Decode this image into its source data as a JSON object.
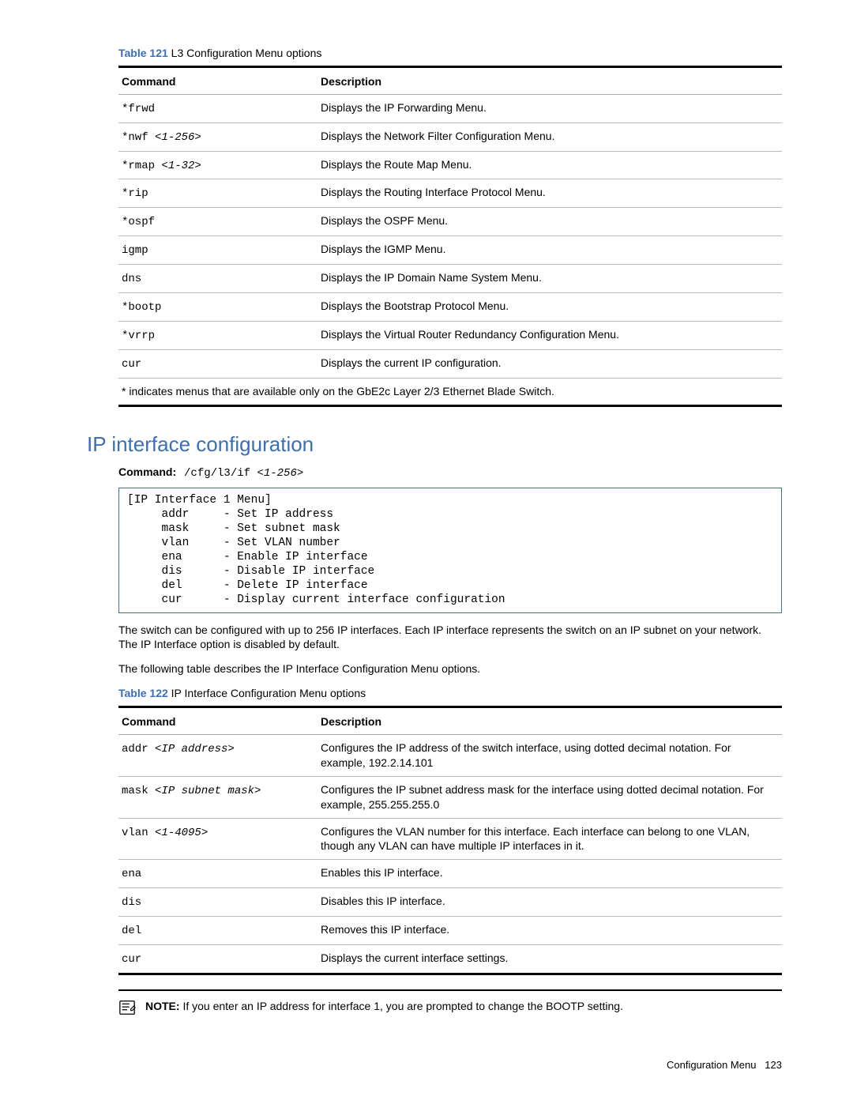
{
  "table121": {
    "prefix": "Table 121",
    "caption": "L3 Configuration Menu options",
    "head_cmd": "Command",
    "head_desc": "Description",
    "rows": [
      {
        "cmd": "*frwd",
        "arg": "",
        "desc": "Displays the IP Forwarding Menu."
      },
      {
        "cmd": "*nwf ",
        "arg": "<1-256>",
        "desc": "Displays the Network Filter Configuration Menu."
      },
      {
        "cmd": "*rmap ",
        "arg": "<1-32>",
        "desc": "Displays the Route Map Menu."
      },
      {
        "cmd": "*rip",
        "arg": "",
        "desc": "Displays the Routing Interface Protocol Menu."
      },
      {
        "cmd": "*ospf",
        "arg": "",
        "desc": "Displays the OSPF Menu."
      },
      {
        "cmd": "igmp",
        "arg": "",
        "desc": "Displays the IGMP Menu."
      },
      {
        "cmd": "dns",
        "arg": "",
        "desc": "Displays the IP Domain Name System Menu."
      },
      {
        "cmd": "*bootp",
        "arg": "",
        "desc": "Displays the Bootstrap Protocol Menu."
      },
      {
        "cmd": "*vrrp",
        "arg": "",
        "desc": "Displays the Virtual Router Redundancy Configuration Menu."
      },
      {
        "cmd": "cur",
        "arg": "",
        "desc": "Displays the current IP configuration."
      }
    ],
    "footnote": "* indicates menus that are available only on the GbE2c Layer 2/3 Ethernet Blade Switch."
  },
  "section_title": "IP interface configuration",
  "cmdline": {
    "label": "Command:",
    "path": "/cfg/l3/if ",
    "arg": "<1-256>"
  },
  "menu_box": "[IP Interface 1 Menu]\n     addr     - Set IP address\n     mask     - Set subnet mask\n     vlan     - Set VLAN number\n     ena      - Enable IP interface\n     dis      - Disable IP interface\n     del      - Delete IP interface\n     cur      - Display current interface configuration",
  "para1": "The switch can be configured with up to 256 IP interfaces. Each IP interface represents the switch on an IP subnet on your network. The IP Interface option is disabled by default.",
  "para2": "The following table describes the IP Interface Configuration Menu options.",
  "table122": {
    "prefix": "Table 122",
    "caption": "IP Interface Configuration Menu options",
    "head_cmd": "Command",
    "head_desc": "Description",
    "rows": [
      {
        "cmd": "addr ",
        "arg": "<IP address>",
        "desc": "Configures the IP address of the switch interface, using dotted decimal notation. For example, 192.2.14.101"
      },
      {
        "cmd": "mask ",
        "arg": "<IP subnet mask>",
        "desc": "Configures the IP subnet address mask for the interface using dotted decimal notation. For example, 255.255.255.0"
      },
      {
        "cmd": "vlan ",
        "arg": "<1-4095>",
        "desc": "Configures the VLAN number for this interface. Each interface can belong to one VLAN, though any VLAN can have multiple IP interfaces in it."
      },
      {
        "cmd": "ena",
        "arg": "",
        "desc": "Enables this IP interface."
      },
      {
        "cmd": "dis",
        "arg": "",
        "desc": "Disables this IP interface."
      },
      {
        "cmd": "del",
        "arg": "",
        "desc": "Removes this IP interface."
      },
      {
        "cmd": "cur",
        "arg": "",
        "desc": "Displays the current interface settings."
      }
    ]
  },
  "note": {
    "label": "NOTE:",
    "text": "If you enter an IP address for interface 1, you are prompted to change the BOOTP setting."
  },
  "footer": {
    "section": "Configuration Menu",
    "page": "123"
  }
}
